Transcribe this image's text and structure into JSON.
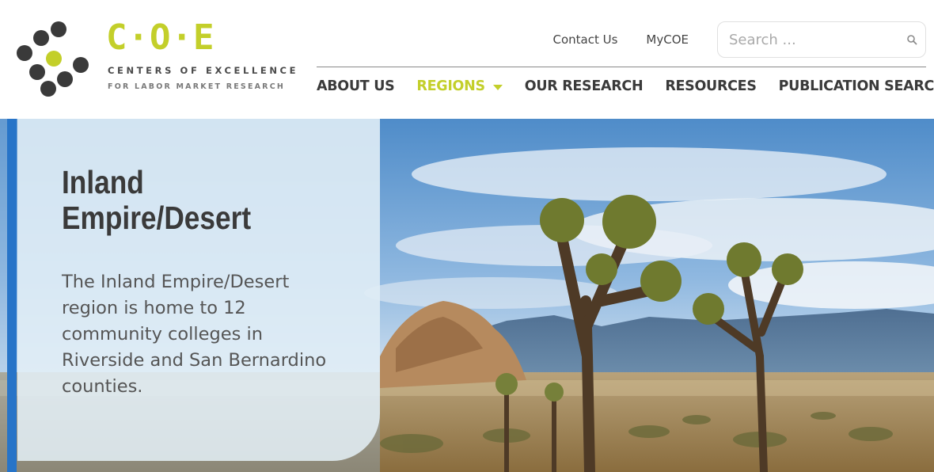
{
  "logo": {
    "wordmark": "C·O·E",
    "line1": "CENTERS OF EXCELLENCE",
    "line2": "FOR LABOR MARKET RESEARCH",
    "accent_color": "#c3cf2a",
    "dot_color": "#3a3a3a"
  },
  "utility": {
    "contact_label": "Contact Us",
    "mycoe_label": "MyCOE",
    "search_placeholder": "Search ...",
    "search_icon": "search-icon"
  },
  "nav": {
    "items": [
      {
        "label": "ABOUT US",
        "active": false
      },
      {
        "label": "REGIONS",
        "active": true,
        "dropdown": true
      },
      {
        "label": "OUR RESEARCH",
        "active": false
      },
      {
        "label": "RESOURCES",
        "active": false
      },
      {
        "label": "PUBLICATION SEARCH",
        "active": false
      }
    ],
    "active_color": "#c3cf2a"
  },
  "hero": {
    "title": "Inland Empire/Desert",
    "description": "The Inland Empire/Desert region is home to 12 community colleges in Riverside and San Bernardino counties.",
    "edge_color": "#2774c8"
  }
}
